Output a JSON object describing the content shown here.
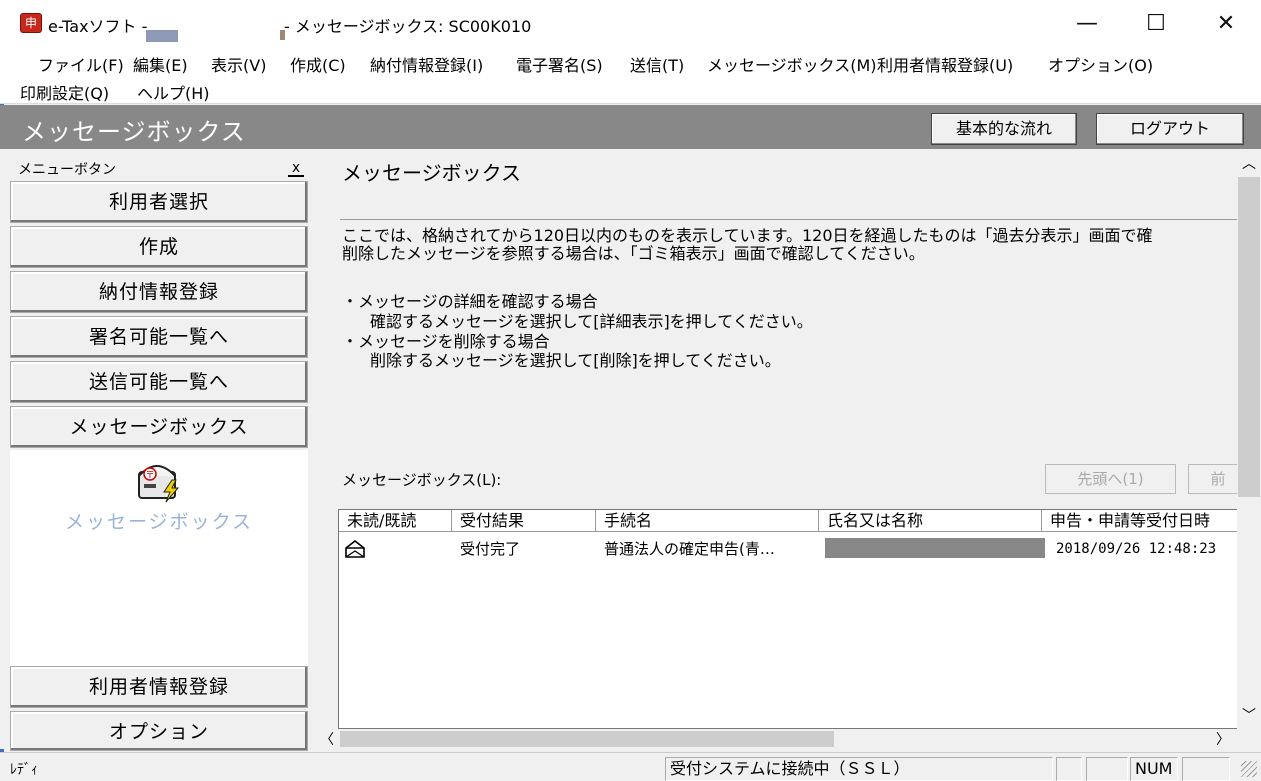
{
  "window": {
    "app_name": "e-Taxソフト -",
    "title_rest": "- メッセージボックス: SC00K010",
    "minimize": "—",
    "maximize": "☐",
    "close": "✕"
  },
  "menu": {
    "row1": [
      "ファイル(F)",
      "編集(E)",
      "表示(V)",
      "作成(C)",
      "納付情報登録(I)",
      "電子署名(S)",
      "送信(T)",
      "メッセージボックス(M)",
      "利用者情報登録(U)",
      "オプション(O)"
    ],
    "row2": [
      "印刷設定(Q)",
      "ヘルプ(H)"
    ]
  },
  "header": {
    "title": "メッセージボックス",
    "flow_button": "基本的な流れ",
    "logout_button": "ログアウト"
  },
  "sidebar": {
    "title": "メニューボタン",
    "close": "x",
    "buttons": [
      "利用者選択",
      "作成",
      "納付情報登録",
      "署名可能一覧へ",
      "送信可能一覧へ",
      "メッセージボックス"
    ],
    "icon_label": "メッセージボックス",
    "bottom_buttons": [
      "利用者情報登録",
      "オプション"
    ]
  },
  "main": {
    "title": "メッセージボックス",
    "intro_line1": "ここでは、格納されてから120日以内のものを表示しています。120日を経過したものは「過去分表示」画面で確",
    "intro_line2": "削除したメッセージを参照する場合は、「ゴミ箱表示」画面で確認してください。",
    "bullet1": "・メッセージの詳細を確認する場合",
    "bullet1_detail": "確認するメッセージを選択して[詳細表示]を押してください。",
    "bullet2": "・メッセージを削除する場合",
    "bullet2_detail": "削除するメッセージを選択して[削除]を押してください。",
    "list_label": "メッセージボックス(L):",
    "first_button": "先頭へ(1)",
    "prev_button": "前"
  },
  "table": {
    "columns": [
      "未読/既読",
      "受付結果",
      "手続名",
      "氏名又は名称",
      "申告・申請等受付日時"
    ],
    "rows": [
      {
        "read_icon": "opened-envelope-icon",
        "result": "受付完了",
        "procedure": "普通法人の確定申告(青…",
        "name": "",
        "datetime": "2018/09/26 12:48:23"
      }
    ]
  },
  "status": {
    "left": "ﾚﾃﾞｨ",
    "connection": "受付システムに接続中（ＳＳＬ）",
    "num": "NUM"
  }
}
